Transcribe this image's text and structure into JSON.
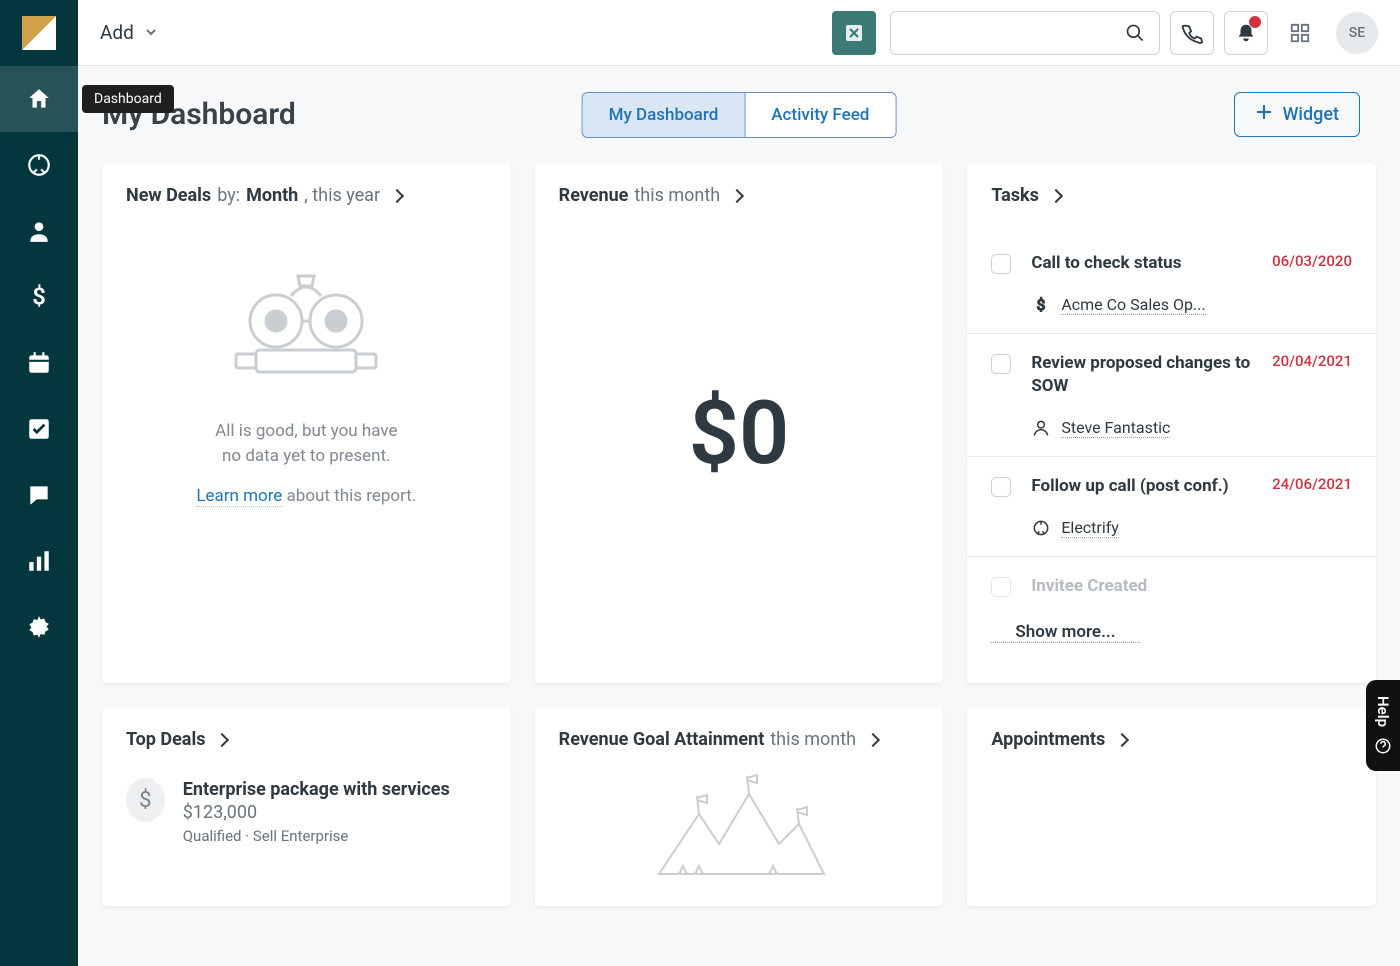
{
  "page_title": "My Dashboard",
  "tooltip": "Dashboard",
  "add_label": "Add",
  "avatar_initials": "SE",
  "segments": {
    "my_dashboard": "My Dashboard",
    "activity_feed": "Activity Feed"
  },
  "widget_button": "Widget",
  "new_deals": {
    "label": "New Deals",
    "by": " by: ",
    "period_bold": "Month",
    "period_rest": ", this year",
    "empty1": "All is good, but you have",
    "empty2": "no data yet to present.",
    "learn": "Learn more",
    "about": " about this report."
  },
  "revenue": {
    "label": "Revenue",
    "period": " this month",
    "value": "$0"
  },
  "tasks": {
    "label": "Tasks",
    "show_more": "Show more...",
    "items": [
      {
        "title": "Call to check status",
        "date": "06/03/2020",
        "link_icon": "dollar",
        "link": "Acme Co Sales Op..."
      },
      {
        "title": "Review proposed changes to SOW",
        "date": "20/04/2021",
        "link_icon": "person",
        "link": "Steve Fantastic"
      },
      {
        "title": "Follow up call (post conf.)",
        "date": "24/06/2021",
        "link_icon": "lead",
        "link": "Electrify"
      },
      {
        "title": "Invitee Created",
        "date": "",
        "link_icon": "",
        "link": "",
        "faded": true
      }
    ]
  },
  "top_deals": {
    "label": "Top Deals",
    "deal": {
      "title": "Enterprise package with services",
      "amount": " $123,000",
      "meta": "Qualified · Sell Enterprise"
    }
  },
  "revenue_goal": {
    "label": "Revenue Goal Attainment",
    "period": " this month"
  },
  "appointments": {
    "label": "Appointments"
  },
  "help_label": "Help"
}
